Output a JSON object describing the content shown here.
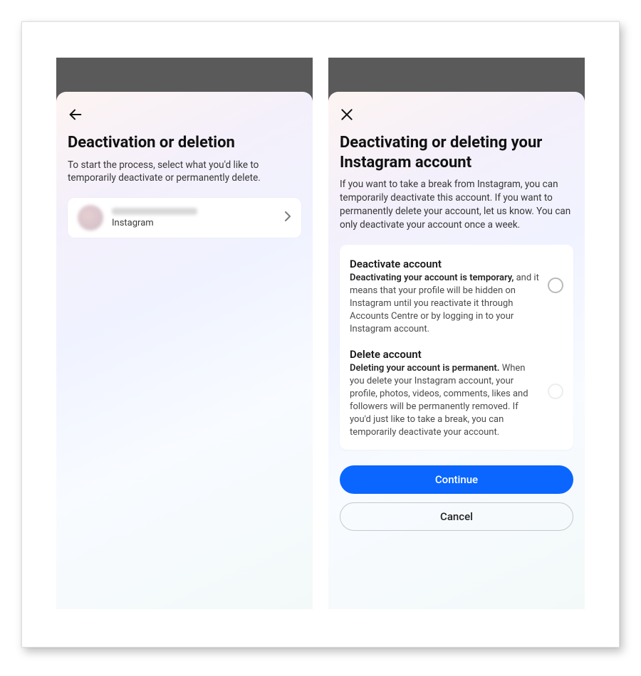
{
  "screen1": {
    "title": "Deactivation or deletion",
    "subtitle": "To start the process, select what you'd like to temporarily deactivate or permanently delete.",
    "account_platform": "Instagram"
  },
  "screen2": {
    "title": "Deactivating or deleting your Instagram account",
    "subtitle": "If you want to take a break from Instagram, you can temporarily deactivate this account. If you want to permanently delete your account, let us know.  You can only deactivate your account once a week.",
    "option_deactivate": {
      "title": "Deactivate account",
      "lead": "Deactivating your account is temporary,",
      "rest": " and it means that your profile will be hidden on Instagram until you reactivate it through Accounts Centre or by logging in to your Instagram account."
    },
    "option_delete": {
      "title": "Delete account",
      "lead": "Deleting your account is permanent.",
      "rest": " When you delete your Instagram account, your profile, photos, videos, comments, likes and followers will be permanently removed. If you'd just like to take a break, you can temporarily deactivate your account."
    },
    "continue_label": "Continue",
    "cancel_label": "Cancel"
  },
  "colors": {
    "primary_button": "#0a66ff"
  }
}
